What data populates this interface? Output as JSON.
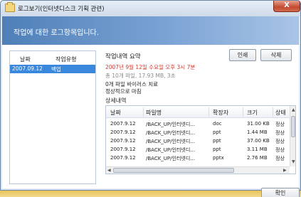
{
  "window": {
    "title": "로그보기(인터넷디스크 기획 관련)",
    "close_glyph": "X"
  },
  "header": {
    "text": "작업에 대한 로그항목입니다."
  },
  "left_list": {
    "columns": [
      "날짜",
      "작업유형"
    ],
    "rows": [
      {
        "date": "2007.09.12",
        "type": "백업",
        "selected": true
      }
    ]
  },
  "summary": {
    "title": "작업내역 요약",
    "print_label": "인쇄",
    "delete_label": "삭제",
    "time_line": "2007년 9월 12일 수요일 오후 3시 7분",
    "stats_line": "총 10개 파일, 17.93 MB, 3초",
    "binary_line": "0개 파일 바이러스 치료",
    "result_line": "정상적으로 마침"
  },
  "details": {
    "title": "상세내역",
    "columns": [
      "날짜",
      "파일명",
      "확장자",
      "크기",
      "상태"
    ],
    "rows": [
      {
        "date": "2007.9.12",
        "file": "/BACK_UP/인터넷디...",
        "ext": "doc",
        "size": "31.00 KB",
        "status": "정상"
      },
      {
        "date": "2007.9.12",
        "file": "/BACK_UP/인터넷디...",
        "ext": "ppt",
        "size": "1.44 MB",
        "status": "정상"
      },
      {
        "date": "2007.9.12",
        "file": "/BACK_UP/인터넷디...",
        "ext": "ppt",
        "size": "37.00 KB",
        "status": "정상"
      },
      {
        "date": "2007.9.12",
        "file": "/BACK_UP/인터넷디...",
        "ext": "ppt",
        "size": "3.11 MB",
        "status": "정상"
      },
      {
        "date": "2007.9.12",
        "file": "/BACK_UP/인터넷디...",
        "ext": "pptx",
        "size": "2.76 MB",
        "status": "정상"
      }
    ],
    "scroll_up_glyph": "▲",
    "scroll_down_glyph": "▼",
    "scroll_left_glyph": "◀",
    "scroll_right_glyph": "▶"
  },
  "footer": {
    "confirm_label": "확인"
  },
  "colors": {
    "banner": "#4f7fb8",
    "selection": "#3a88dd",
    "red_text": "#d23a2a",
    "close_button": "#c24a30"
  }
}
